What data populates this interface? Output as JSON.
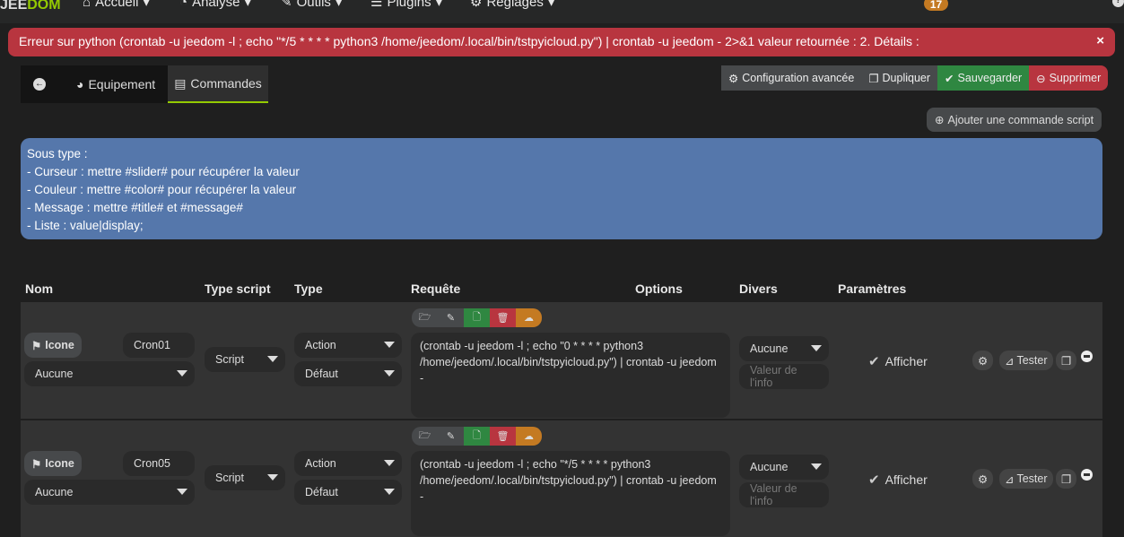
{
  "nav": {
    "logo_prefix": "J",
    "logo_a": "EE",
    "logo_b": "DOM",
    "items": [
      "Accueil",
      "Analyse",
      "Outils",
      "Plugins",
      "Réglages"
    ],
    "badge": "17",
    "help": "?"
  },
  "alert": {
    "text": "Erreur sur python (crontab -u jeedom -l ; echo \"*/5 * * * * python3 /home/jeedom/.local/bin/tstpyicloud.py\") | crontab -u jeedom - 2>&1 valeur retournée : 2. Détails :",
    "close": "×"
  },
  "tabs": {
    "equipement": "Equipement",
    "commandes": "Commandes"
  },
  "toolbar": {
    "config": "Configuration avancée",
    "dupliquer": "Dupliquer",
    "sauvegarder": "Sauvegarder",
    "supprimer": "Supprimer",
    "add": "Ajouter une commande script"
  },
  "info": [
    "Sous type :",
    "- Curseur : mettre #slider# pour récupérer la valeur",
    "- Couleur : mettre #color# pour récupérer la valeur",
    "- Message : mettre #title# et #message#",
    "- Liste : value|display;"
  ],
  "headers": {
    "nom": "Nom",
    "type_script": "Type script",
    "type": "Type",
    "requete": "Requête",
    "options": "Options",
    "divers": "Divers",
    "parametres": "Paramètres"
  },
  "rows": [
    {
      "icone": "Icone",
      "name": "Cron01",
      "icon_select": "Aucune",
      "script": "Script",
      "type": "Action",
      "subtype": "Défaut",
      "request": "(crontab -u jeedom -l ; echo \"0 * * * * python3 /home/jeedom/.local/bin/tstpyicloud.py\") | crontab -u jeedom -",
      "divers": "Aucune",
      "valeur_placeholder": "Valeur de l'info",
      "afficher": "Afficher",
      "tester": "Tester"
    },
    {
      "icone": "Icone",
      "name": "Cron05",
      "icon_select": "Aucune",
      "script": "Script",
      "type": "Action",
      "subtype": "Défaut",
      "request": "(crontab -u jeedom -l ; echo \"*/5 * * * * python3 /home/jeedom/.local/bin/tstpyicloud.py\") | crontab -u jeedom -",
      "divers": "Aucune",
      "valeur_placeholder": "Valeur de l'info",
      "afficher": "Afficher",
      "tester": "Tester"
    }
  ]
}
